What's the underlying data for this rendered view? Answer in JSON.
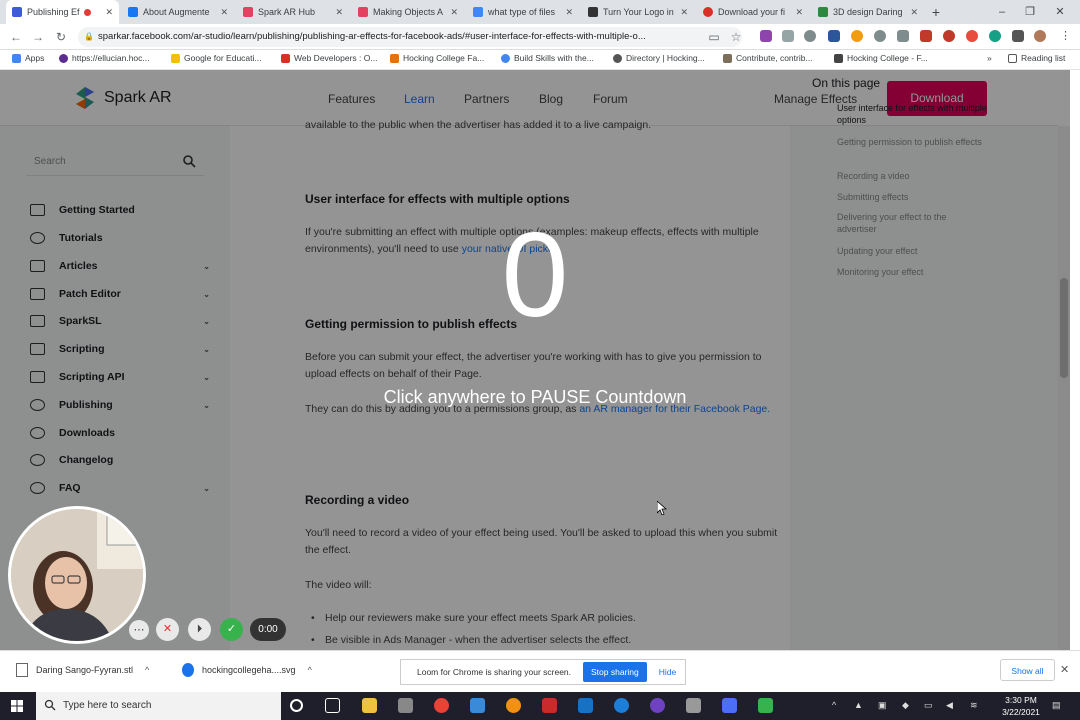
{
  "browser": {
    "tabs": [
      {
        "label": "Publishing Ef",
        "color": "#3b5bdb",
        "active": true
      },
      {
        "label": "About Augmente",
        "color": "#1877f2"
      },
      {
        "label": "Spark AR Hub",
        "color": "#e4405f"
      },
      {
        "label": "Making Objects A",
        "color": "#e4405f"
      },
      {
        "label": "what type of files",
        "color": "#4285f4"
      },
      {
        "label": "Turn Your Logo in",
        "color": "#333333"
      },
      {
        "label": "Download your fi",
        "color": "#d93025"
      },
      {
        "label": "3D design Daring",
        "color": "#2b8a3e"
      }
    ],
    "new_tab": "+",
    "window_controls": {
      "minimize": "–",
      "maximize": "❐",
      "close": "✕"
    },
    "url": "sparkar.facebook.com/ar-studio/learn/publishing/publishing-ar-effects-for-facebook-ads/#user-interface-for-effects-with-multiple-o...",
    "bookmarks": [
      {
        "label": "Apps",
        "color": "#4285f4"
      },
      {
        "label": "https://ellucian.hoc...",
        "color": "#5c2d91"
      },
      {
        "label": "Google for Educati...",
        "color": "#fbbc05"
      },
      {
        "label": "Web Developers : O...",
        "color": "#d93025"
      },
      {
        "label": "Hocking College Fa...",
        "color": "#e8710a"
      },
      {
        "label": "Build Skills with the...",
        "color": "#4285f4"
      },
      {
        "label": "Directory | Hocking...",
        "color": "#555555"
      },
      {
        "label": "Contribute, contrib...",
        "color": "#7b6f5a"
      },
      {
        "label": "Hocking College - F...",
        "color": "#444444"
      }
    ],
    "reading_list": "Reading list"
  },
  "site": {
    "logo_text": "Spark AR",
    "nav": [
      "Features",
      "Learn",
      "Partners",
      "Blog",
      "Forum"
    ],
    "manage": "Manage Effects",
    "download": "Download",
    "search_placeholder": "Search",
    "sidebar": [
      {
        "label": "Getting Started",
        "chevron": false
      },
      {
        "label": "Tutorials",
        "chevron": false
      },
      {
        "label": "Articles",
        "chevron": true
      },
      {
        "label": "Patch Editor",
        "chevron": true
      },
      {
        "label": "SparkSL",
        "chevron": true
      },
      {
        "label": "Scripting",
        "chevron": true
      },
      {
        "label": "Scripting API",
        "chevron": true
      },
      {
        "label": "Publishing",
        "chevron": true
      },
      {
        "label": "Downloads",
        "chevron": false
      },
      {
        "label": "Changelog",
        "chevron": false
      },
      {
        "label": "FAQ",
        "chevron": true
      }
    ]
  },
  "article": {
    "intro": "available to the public when the advertiser has added it to a live campaign.",
    "h1": "User interface for effects with multiple options",
    "p1a": "If you're submitting an effect with multiple options (examples: makeup effects, effects with multiple environments), you'll need to use",
    "p1link": "your native UI picker.",
    "h2": "Getting permission to publish effects",
    "p2": "Before you can submit your effect, the advertiser you're working with has to give you permission to upload effects on behalf of their Page.",
    "p3a": "They can do this by adding you to a permissions group, as",
    "p3link": "an AR manager for their Facebook Page.",
    "h3": "Recording a video",
    "p4": "You'll need to record a video of your effect being used. You'll be asked to upload this when you submit the effect.",
    "p5": "The video will:",
    "bullets": [
      "Help our reviewers make sure your effect meets Spark AR policies.",
      "Be visible in Ads Manager - when the advertiser selects the effect."
    ]
  },
  "toc": {
    "heading": "On this page",
    "items": [
      "User interface for effects with multiple options",
      "Getting permission to publish effects",
      "Recording a video",
      "Submitting effects",
      "Delivering your effect to the advertiser",
      "Updating your effect",
      "Monitoring your effect"
    ]
  },
  "overlay": {
    "countdown": "0",
    "message": "Click anywhere to PAUSE Countdown"
  },
  "loom": {
    "timer": "0:00",
    "share_text": "Loom for Chrome is sharing your screen.",
    "stop": "Stop sharing",
    "hide": "Hide"
  },
  "downloads": {
    "items": [
      "Daring Sango-Fyyran.stl",
      "hockingcollegeha....svg"
    ],
    "show_all": "Show all"
  },
  "taskbar": {
    "search_placeholder": "Type here to search",
    "time": "3:30 PM",
    "date": "3/22/2021"
  }
}
